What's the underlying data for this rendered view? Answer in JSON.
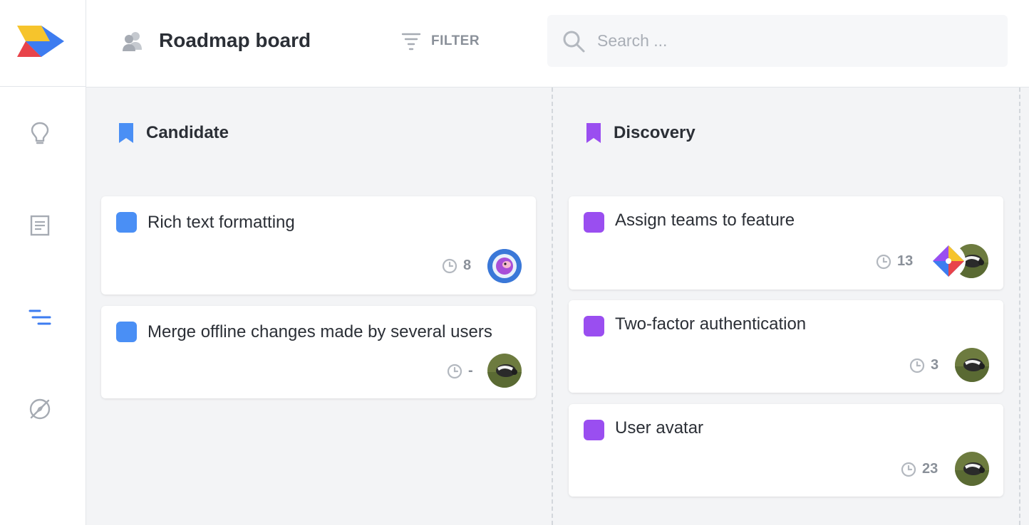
{
  "header": {
    "title": "Roadmap board",
    "filter_label": "FILTER",
    "search_placeholder": "Search ..."
  },
  "sidebar": {
    "items": [
      {
        "icon": "lightbulb-icon"
      },
      {
        "icon": "document-icon"
      },
      {
        "icon": "roadmap-lines-icon",
        "active": true
      },
      {
        "icon": "compass-icon"
      }
    ]
  },
  "columns": [
    {
      "title": "Candidate",
      "color": "#4a8ff5",
      "cards": [
        {
          "title": "Rich text formatting",
          "count": "8",
          "avatar": "astronaut-avatar"
        },
        {
          "title": "Merge offline changes made by several users",
          "count": "-",
          "avatar": "photo-avatar"
        }
      ]
    },
    {
      "title": "Discovery",
      "color": "#9a4ef0",
      "cards": [
        {
          "title": "Assign teams to feature",
          "count": "13",
          "avatar": "team-logo-and-photo-avatar"
        },
        {
          "title": "Two-factor authentication",
          "count": "3",
          "avatar": "photo-avatar"
        },
        {
          "title": "User avatar",
          "count": "23",
          "avatar": "photo-avatar"
        }
      ]
    }
  ],
  "colors": {
    "accent_blue": "#4a8ff5",
    "accent_purple": "#9a4ef0",
    "board_bg": "#f3f4f6",
    "muted_text": "#8a9099"
  }
}
